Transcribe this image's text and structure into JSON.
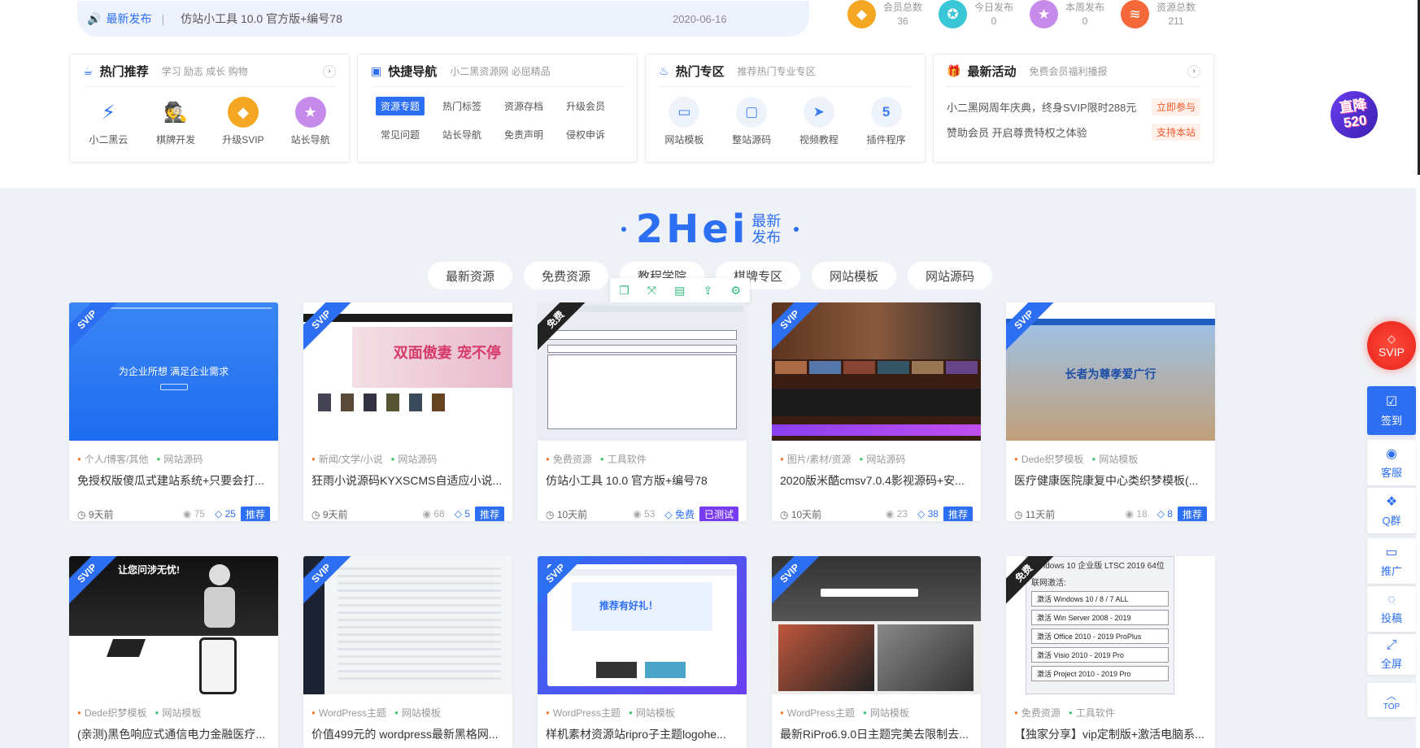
{
  "notice": {
    "tag": "最新发布",
    "sep": "|",
    "title": "仿站小工具 10.0 官方版+编号78",
    "date": "2020-06-16"
  },
  "stats": [
    {
      "label": "会员总数",
      "value": "36",
      "icon": "diamond-icon",
      "color": "#f5a623"
    },
    {
      "label": "今日发布",
      "value": "0",
      "icon": "compass-icon",
      "color": "#39c6d6"
    },
    {
      "label": "本周发布",
      "value": "0",
      "icon": "star-icon",
      "color": "#c68bea"
    },
    {
      "label": "资源总数",
      "value": "211",
      "icon": "layers-icon",
      "color": "#f5683a"
    }
  ],
  "hot": {
    "title": "热门推荐",
    "desc": "学习 励志 成长 购物",
    "more": "›",
    "items": [
      {
        "label": "小二黑云",
        "icon": "lightning-icon",
        "glyph": "⚡"
      },
      {
        "label": "棋牌开发",
        "icon": "spy-icon",
        "glyph": "🕵"
      },
      {
        "label": "升级SVIP",
        "icon": "diamond-icon",
        "glyph": "◆"
      },
      {
        "label": "站长导航",
        "icon": "star-icon",
        "glyph": "★"
      }
    ]
  },
  "quick": {
    "title": "快捷导航",
    "desc": "小二黑资源网 必屈精品",
    "items": [
      "资源专题",
      "热门标签",
      "资源存档",
      "升级会员",
      "常见问题",
      "站长导航",
      "免责声明",
      "侵权申诉"
    ]
  },
  "zone": {
    "title": "热门专区",
    "desc": "推荐热门专业专区",
    "items": [
      {
        "label": "网站模板",
        "icon": "laptop-icon",
        "glyph": "▭"
      },
      {
        "label": "整站源码",
        "icon": "monitor-icon",
        "glyph": "🖥"
      },
      {
        "label": "视频教程",
        "icon": "paper-plane-icon",
        "glyph": "➤"
      },
      {
        "label": "插件程序",
        "icon": "html5-icon",
        "glyph": "5"
      }
    ]
  },
  "activity": {
    "title": "最新活动",
    "desc": "免费会员福利播报",
    "more": "›",
    "rows": [
      {
        "text": "小二黑网周年庆典，终身SVIP限时288元",
        "btn": "立即参与"
      },
      {
        "text": "赞助会员 开启尊贵特权之体验",
        "btn": "支持本站"
      }
    ]
  },
  "float_badge": {
    "line1": "直降",
    "line2": "520"
  },
  "section": {
    "big": "2Hei",
    "small1": "最新",
    "small2": "发布"
  },
  "filters": [
    "最新资源",
    "免费资源",
    "教程学院",
    "棋牌专区",
    "网站模板",
    "网站源码"
  ],
  "toolbar_icons": [
    "copy-icon",
    "expand-icon",
    "save-icon",
    "share-icon",
    "settings-icon"
  ],
  "cards": [
    {
      "ribbon": "SVIP",
      "cat1": "个人/博客/其他",
      "cat2": "网站源码",
      "title": "免授权版傻瓜式建站系统+只要会打...",
      "time": "9天前",
      "views": "75",
      "price": "25",
      "badge": "推荐",
      "thumb_text": "为企业所想 满足企业需求",
      "thumb": "blue"
    },
    {
      "ribbon": "SVIP",
      "cat1": "新闻/文学/小说",
      "cat2": "网站源码",
      "title": "狂雨小说源码KYXSCMS自适应小说...",
      "time": "9天前",
      "views": "68",
      "price": "5",
      "badge": "推荐",
      "thumb_text": "双面傲妻 宠不停",
      "thumb": "novel"
    },
    {
      "ribbon": "免费",
      "cat1": "免费资源",
      "cat2": "工具软件",
      "title": "仿站小工具 10.0 官方版+编号78",
      "time": "10天前",
      "views": "53",
      "price": "免费",
      "badge": "已测试",
      "thumb_text": "",
      "thumb": "tool"
    },
    {
      "ribbon": "SVIP",
      "cat1": "图片/素材/资源",
      "cat2": "网站源码",
      "title": "2020版米酷cmsv7.0.4影视源码+安...",
      "time": "10天前",
      "views": "23",
      "price": "38",
      "badge": "推荐",
      "thumb_text": "",
      "thumb": "movie"
    },
    {
      "ribbon": "SVIP",
      "cat1": "Dede织梦模板",
      "cat2": "网站模板",
      "title": "医疗健康医院康复中心类织梦模板(...",
      "time": "11天前",
      "views": "18",
      "price": "8",
      "badge": "推荐",
      "thumb_text": "长者为尊孝爱广行",
      "thumb": "hospital"
    },
    {
      "ribbon": "SVIP",
      "cat1": "Dede织梦模板",
      "cat2": "网站模板",
      "title": "(亲测)黑色响应式通信电力金融医疗...",
      "time": "",
      "views": "",
      "price": "",
      "badge": "",
      "thumb_text": "让您问涉无忧!",
      "thumb": "robot"
    },
    {
      "ribbon": "SVIP",
      "cat1": "WordPress主题",
      "cat2": "网站模板",
      "title": "价值499元的 wordpress最新黑格网...",
      "time": "",
      "views": "",
      "price": "",
      "badge": "",
      "thumb_text": "",
      "thumb": "dark"
    },
    {
      "ribbon": "SVIP",
      "cat1": "WordPress主题",
      "cat2": "网站模板",
      "title": "样机素材资源站ripro子主题logohe...",
      "time": "",
      "views": "",
      "price": "",
      "badge": "",
      "thumb_text": "推荐有好礼！",
      "thumb": "mockup"
    },
    {
      "ribbon": "SVIP",
      "cat1": "WordPress主题",
      "cat2": "网站模板",
      "title": "最新RiPro6.9.0日主题完美去限制去...",
      "time": "",
      "views": "",
      "price": "",
      "badge": "",
      "thumb_text": "",
      "thumb": "ripro"
    },
    {
      "ribbon": "免费",
      "cat1": "免费资源",
      "cat2": "工具软件",
      "title": "【独家分享】vip定制版+激活电脑系...",
      "time": "",
      "views": "",
      "price": "",
      "badge": "",
      "thumb_text": "Windows 10 企业版 LTSC 2019 64位",
      "thumb": "activate",
      "activate": {
        "label": "联网激活:",
        "items": [
          "激活 Windows 10 / 8 / 7 ALL",
          "激活 Win Server 2008 - 2019",
          "激活 Office  2010 - 2019 ProPlus",
          "激活  Visio  2010 - 2019 Pro",
          "激活 Project 2010 - 2019 Pro"
        ]
      }
    }
  ],
  "sidebar": {
    "svip": "SVIP",
    "items": [
      {
        "label": "签到",
        "icon": "calendar-icon",
        "glyph": "☑"
      },
      {
        "label": "客服",
        "icon": "qq-icon",
        "glyph": "◉"
      },
      {
        "label": "Q群",
        "icon": "wechat-icon",
        "glyph": "💬"
      },
      {
        "label": "推广",
        "icon": "monitor-icon",
        "glyph": "▭"
      },
      {
        "label": "投稿",
        "icon": "bulb-icon",
        "glyph": "💡"
      },
      {
        "label": "全屏",
        "icon": "fullscreen-icon",
        "glyph": "⤢"
      },
      {
        "label": "TOP",
        "icon": "top-icon",
        "glyph": "︿"
      }
    ]
  },
  "colors": {
    "accent": "#2d6ff3",
    "purple": "#7a3cf0",
    "red": "#e8211b"
  }
}
